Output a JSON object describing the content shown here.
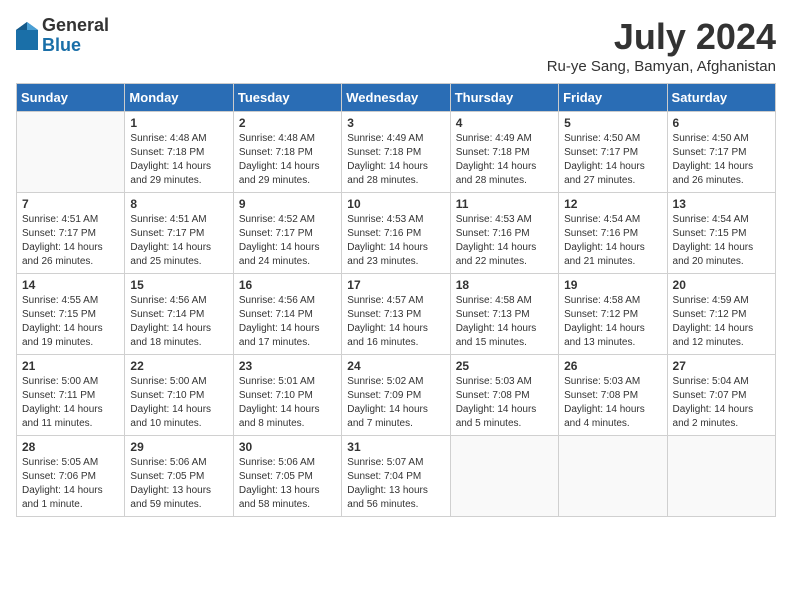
{
  "header": {
    "logo_general": "General",
    "logo_blue": "Blue",
    "month_year": "July 2024",
    "location": "Ru-ye Sang, Bamyan, Afghanistan"
  },
  "weekdays": [
    "Sunday",
    "Monday",
    "Tuesday",
    "Wednesday",
    "Thursday",
    "Friday",
    "Saturday"
  ],
  "weeks": [
    [
      {
        "day": "",
        "info": ""
      },
      {
        "day": "1",
        "info": "Sunrise: 4:48 AM\nSunset: 7:18 PM\nDaylight: 14 hours\nand 29 minutes."
      },
      {
        "day": "2",
        "info": "Sunrise: 4:48 AM\nSunset: 7:18 PM\nDaylight: 14 hours\nand 29 minutes."
      },
      {
        "day": "3",
        "info": "Sunrise: 4:49 AM\nSunset: 7:18 PM\nDaylight: 14 hours\nand 28 minutes."
      },
      {
        "day": "4",
        "info": "Sunrise: 4:49 AM\nSunset: 7:18 PM\nDaylight: 14 hours\nand 28 minutes."
      },
      {
        "day": "5",
        "info": "Sunrise: 4:50 AM\nSunset: 7:17 PM\nDaylight: 14 hours\nand 27 minutes."
      },
      {
        "day": "6",
        "info": "Sunrise: 4:50 AM\nSunset: 7:17 PM\nDaylight: 14 hours\nand 26 minutes."
      }
    ],
    [
      {
        "day": "7",
        "info": "Sunrise: 4:51 AM\nSunset: 7:17 PM\nDaylight: 14 hours\nand 26 minutes."
      },
      {
        "day": "8",
        "info": "Sunrise: 4:51 AM\nSunset: 7:17 PM\nDaylight: 14 hours\nand 25 minutes."
      },
      {
        "day": "9",
        "info": "Sunrise: 4:52 AM\nSunset: 7:17 PM\nDaylight: 14 hours\nand 24 minutes."
      },
      {
        "day": "10",
        "info": "Sunrise: 4:53 AM\nSunset: 7:16 PM\nDaylight: 14 hours\nand 23 minutes."
      },
      {
        "day": "11",
        "info": "Sunrise: 4:53 AM\nSunset: 7:16 PM\nDaylight: 14 hours\nand 22 minutes."
      },
      {
        "day": "12",
        "info": "Sunrise: 4:54 AM\nSunset: 7:16 PM\nDaylight: 14 hours\nand 21 minutes."
      },
      {
        "day": "13",
        "info": "Sunrise: 4:54 AM\nSunset: 7:15 PM\nDaylight: 14 hours\nand 20 minutes."
      }
    ],
    [
      {
        "day": "14",
        "info": "Sunrise: 4:55 AM\nSunset: 7:15 PM\nDaylight: 14 hours\nand 19 minutes."
      },
      {
        "day": "15",
        "info": "Sunrise: 4:56 AM\nSunset: 7:14 PM\nDaylight: 14 hours\nand 18 minutes."
      },
      {
        "day": "16",
        "info": "Sunrise: 4:56 AM\nSunset: 7:14 PM\nDaylight: 14 hours\nand 17 minutes."
      },
      {
        "day": "17",
        "info": "Sunrise: 4:57 AM\nSunset: 7:13 PM\nDaylight: 14 hours\nand 16 minutes."
      },
      {
        "day": "18",
        "info": "Sunrise: 4:58 AM\nSunset: 7:13 PM\nDaylight: 14 hours\nand 15 minutes."
      },
      {
        "day": "19",
        "info": "Sunrise: 4:58 AM\nSunset: 7:12 PM\nDaylight: 14 hours\nand 13 minutes."
      },
      {
        "day": "20",
        "info": "Sunrise: 4:59 AM\nSunset: 7:12 PM\nDaylight: 14 hours\nand 12 minutes."
      }
    ],
    [
      {
        "day": "21",
        "info": "Sunrise: 5:00 AM\nSunset: 7:11 PM\nDaylight: 14 hours\nand 11 minutes."
      },
      {
        "day": "22",
        "info": "Sunrise: 5:00 AM\nSunset: 7:10 PM\nDaylight: 14 hours\nand 10 minutes."
      },
      {
        "day": "23",
        "info": "Sunrise: 5:01 AM\nSunset: 7:10 PM\nDaylight: 14 hours\nand 8 minutes."
      },
      {
        "day": "24",
        "info": "Sunrise: 5:02 AM\nSunset: 7:09 PM\nDaylight: 14 hours\nand 7 minutes."
      },
      {
        "day": "25",
        "info": "Sunrise: 5:03 AM\nSunset: 7:08 PM\nDaylight: 14 hours\nand 5 minutes."
      },
      {
        "day": "26",
        "info": "Sunrise: 5:03 AM\nSunset: 7:08 PM\nDaylight: 14 hours\nand 4 minutes."
      },
      {
        "day": "27",
        "info": "Sunrise: 5:04 AM\nSunset: 7:07 PM\nDaylight: 14 hours\nand 2 minutes."
      }
    ],
    [
      {
        "day": "28",
        "info": "Sunrise: 5:05 AM\nSunset: 7:06 PM\nDaylight: 14 hours\nand 1 minute."
      },
      {
        "day": "29",
        "info": "Sunrise: 5:06 AM\nSunset: 7:05 PM\nDaylight: 13 hours\nand 59 minutes."
      },
      {
        "day": "30",
        "info": "Sunrise: 5:06 AM\nSunset: 7:05 PM\nDaylight: 13 hours\nand 58 minutes."
      },
      {
        "day": "31",
        "info": "Sunrise: 5:07 AM\nSunset: 7:04 PM\nDaylight: 13 hours\nand 56 minutes."
      },
      {
        "day": "",
        "info": ""
      },
      {
        "day": "",
        "info": ""
      },
      {
        "day": "",
        "info": ""
      }
    ]
  ]
}
